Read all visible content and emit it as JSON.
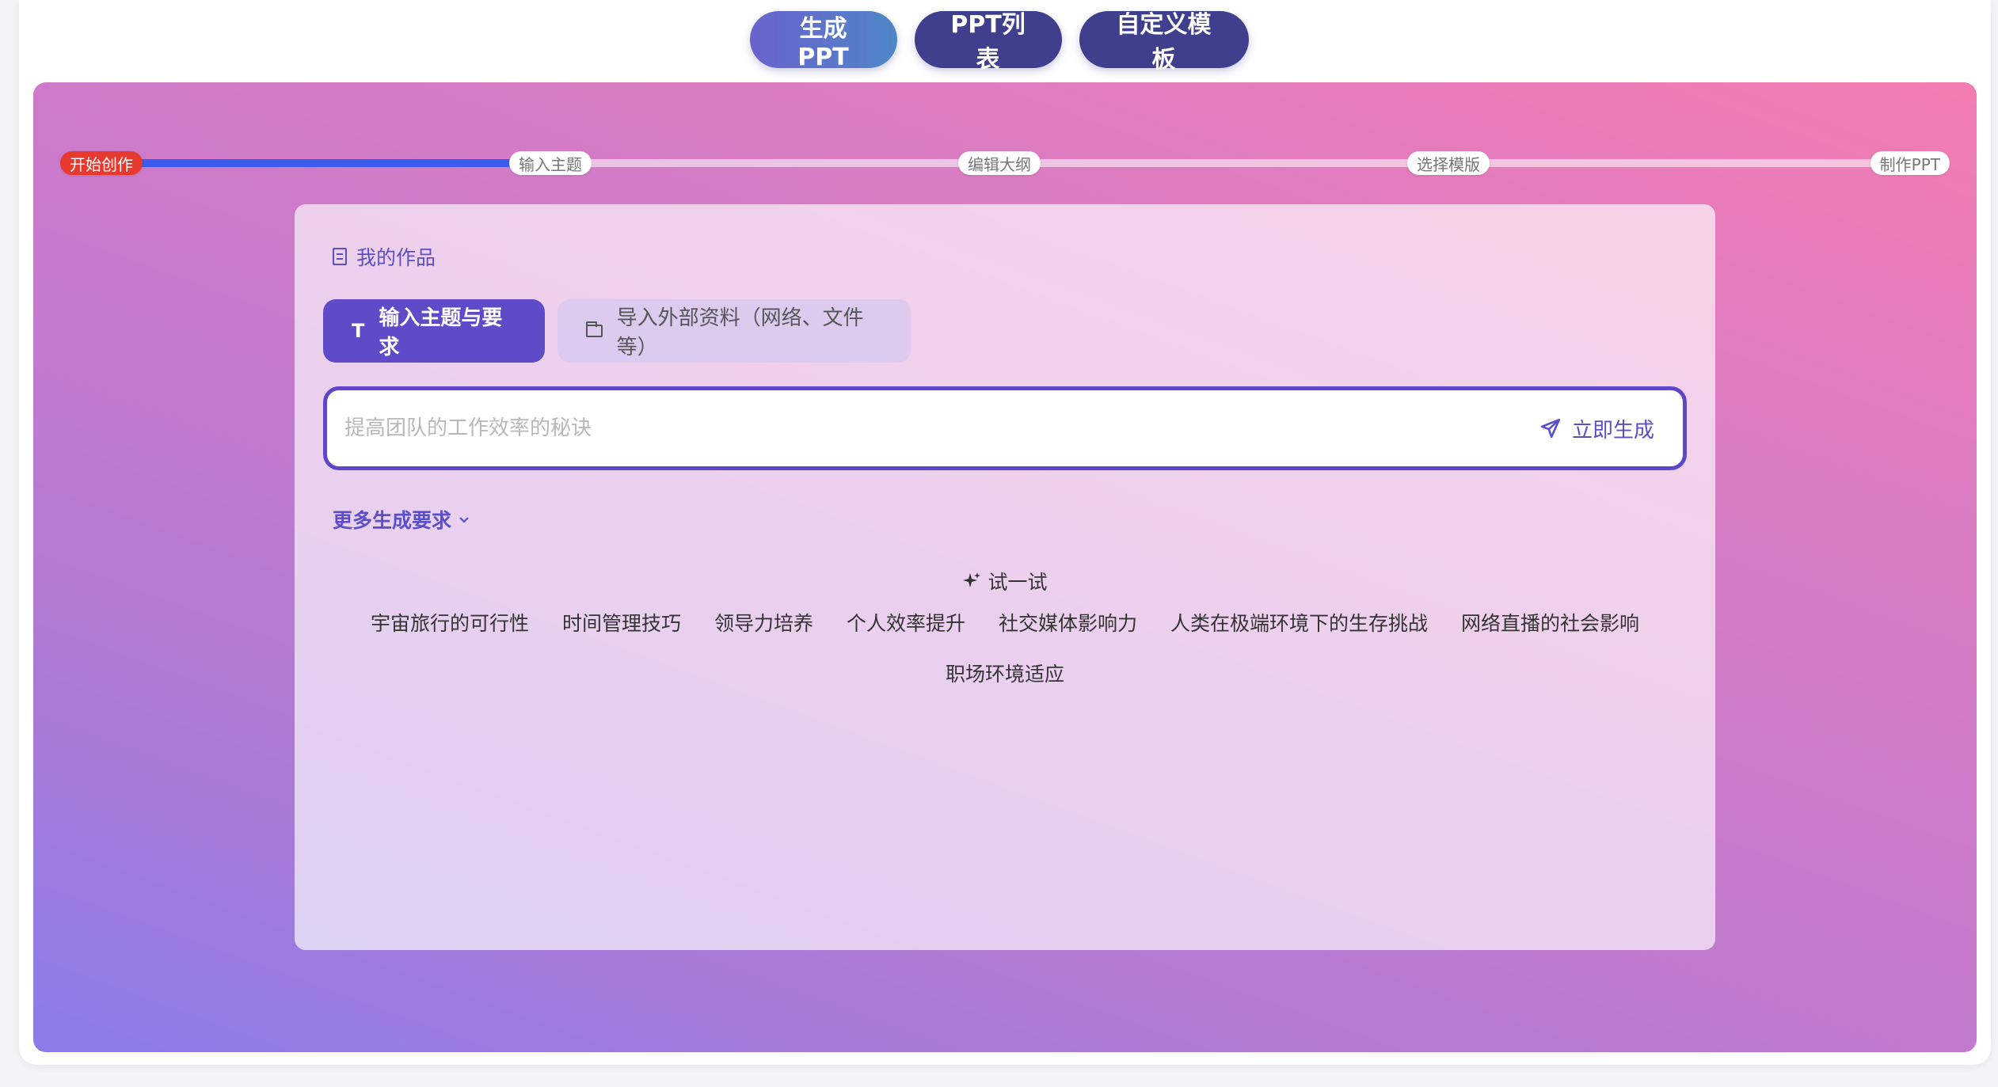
{
  "nav": {
    "tabs": [
      {
        "label": "生成PPT"
      },
      {
        "label": "PPT列表"
      },
      {
        "label": "自定义模板"
      }
    ]
  },
  "progress": {
    "steps": [
      {
        "label": "开始创作"
      },
      {
        "label": "输入主题"
      },
      {
        "label": "编辑大纲"
      },
      {
        "label": "选择模版"
      },
      {
        "label": "制作PPT"
      }
    ],
    "current_step": 1
  },
  "card": {
    "my_works": "我的作品",
    "input_tabs": [
      {
        "label": "输入主题与要求"
      },
      {
        "label": "导入外部资料（网络、文件等）"
      }
    ],
    "search": {
      "placeholder": "提高团队的工作效率的秘诀",
      "value": ""
    },
    "generate_label": "立即生成",
    "more_requirements": "更多生成要求",
    "try_label": "试一试",
    "suggestions": [
      "宇宙旅行的可行性",
      "时间管理技巧",
      "领导力培养",
      "个人效率提升",
      "社交媒体影响力",
      "人类在极端环境下的生存挑战",
      "网络直播的社会影响",
      "职场环境适应"
    ]
  },
  "colors": {
    "accent": "#5e46c6",
    "progress_fill": "#3a5af0",
    "current_step": "#e8392e"
  }
}
